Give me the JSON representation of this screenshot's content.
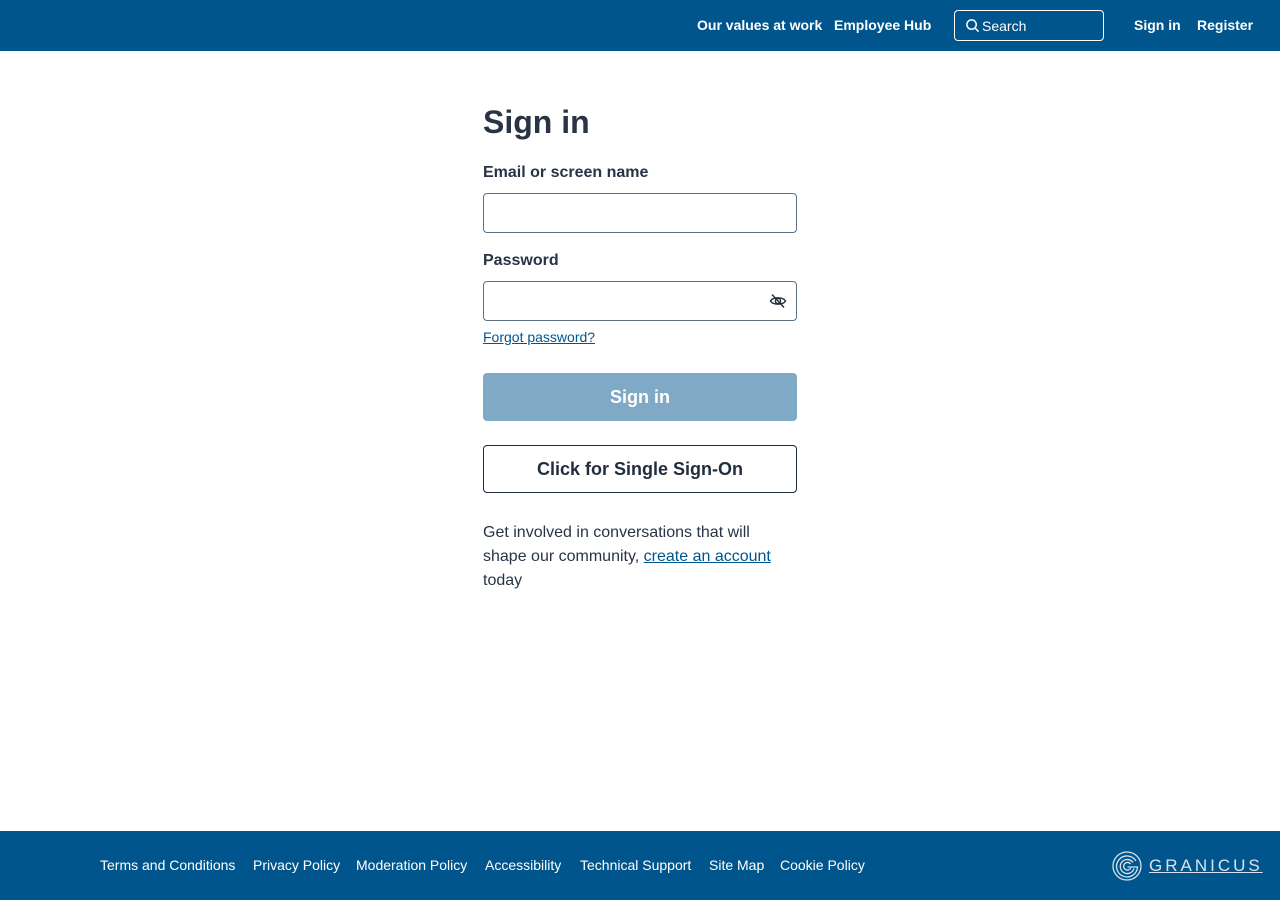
{
  "header": {
    "nav": [
      {
        "label": "Our values at work"
      },
      {
        "label": "Employee Hub"
      }
    ],
    "search": {
      "placeholder": "Search"
    },
    "sign_in": "Sign in",
    "register": "Register"
  },
  "form": {
    "title": "Sign in",
    "email_label": "Email or screen name",
    "email_value": "",
    "password_label": "Password",
    "password_value": "",
    "forgot_password": "Forgot password?",
    "submit_label": "Sign in",
    "sso_label": "Click for Single Sign-On",
    "promo_before": "Get involved in conversations that will shape our community, ",
    "promo_link": "create an account",
    "promo_after": " today"
  },
  "footer": {
    "links": [
      {
        "label": "Terms and Conditions"
      },
      {
        "label": "Privacy Policy"
      },
      {
        "label": "Moderation Policy"
      },
      {
        "label": "Accessibility"
      },
      {
        "label": "Technical Support"
      },
      {
        "label": "Site Map"
      },
      {
        "label": "Cookie Policy"
      }
    ],
    "brand": "GRANICUS"
  },
  "colors": {
    "brand_blue": "#00558c",
    "disabled_button": "#7fa9c5",
    "text": "#283446"
  },
  "icons": {
    "search": "search-icon",
    "password_toggle": "eye-slash-icon",
    "brand": "granicus-logo-icon"
  }
}
